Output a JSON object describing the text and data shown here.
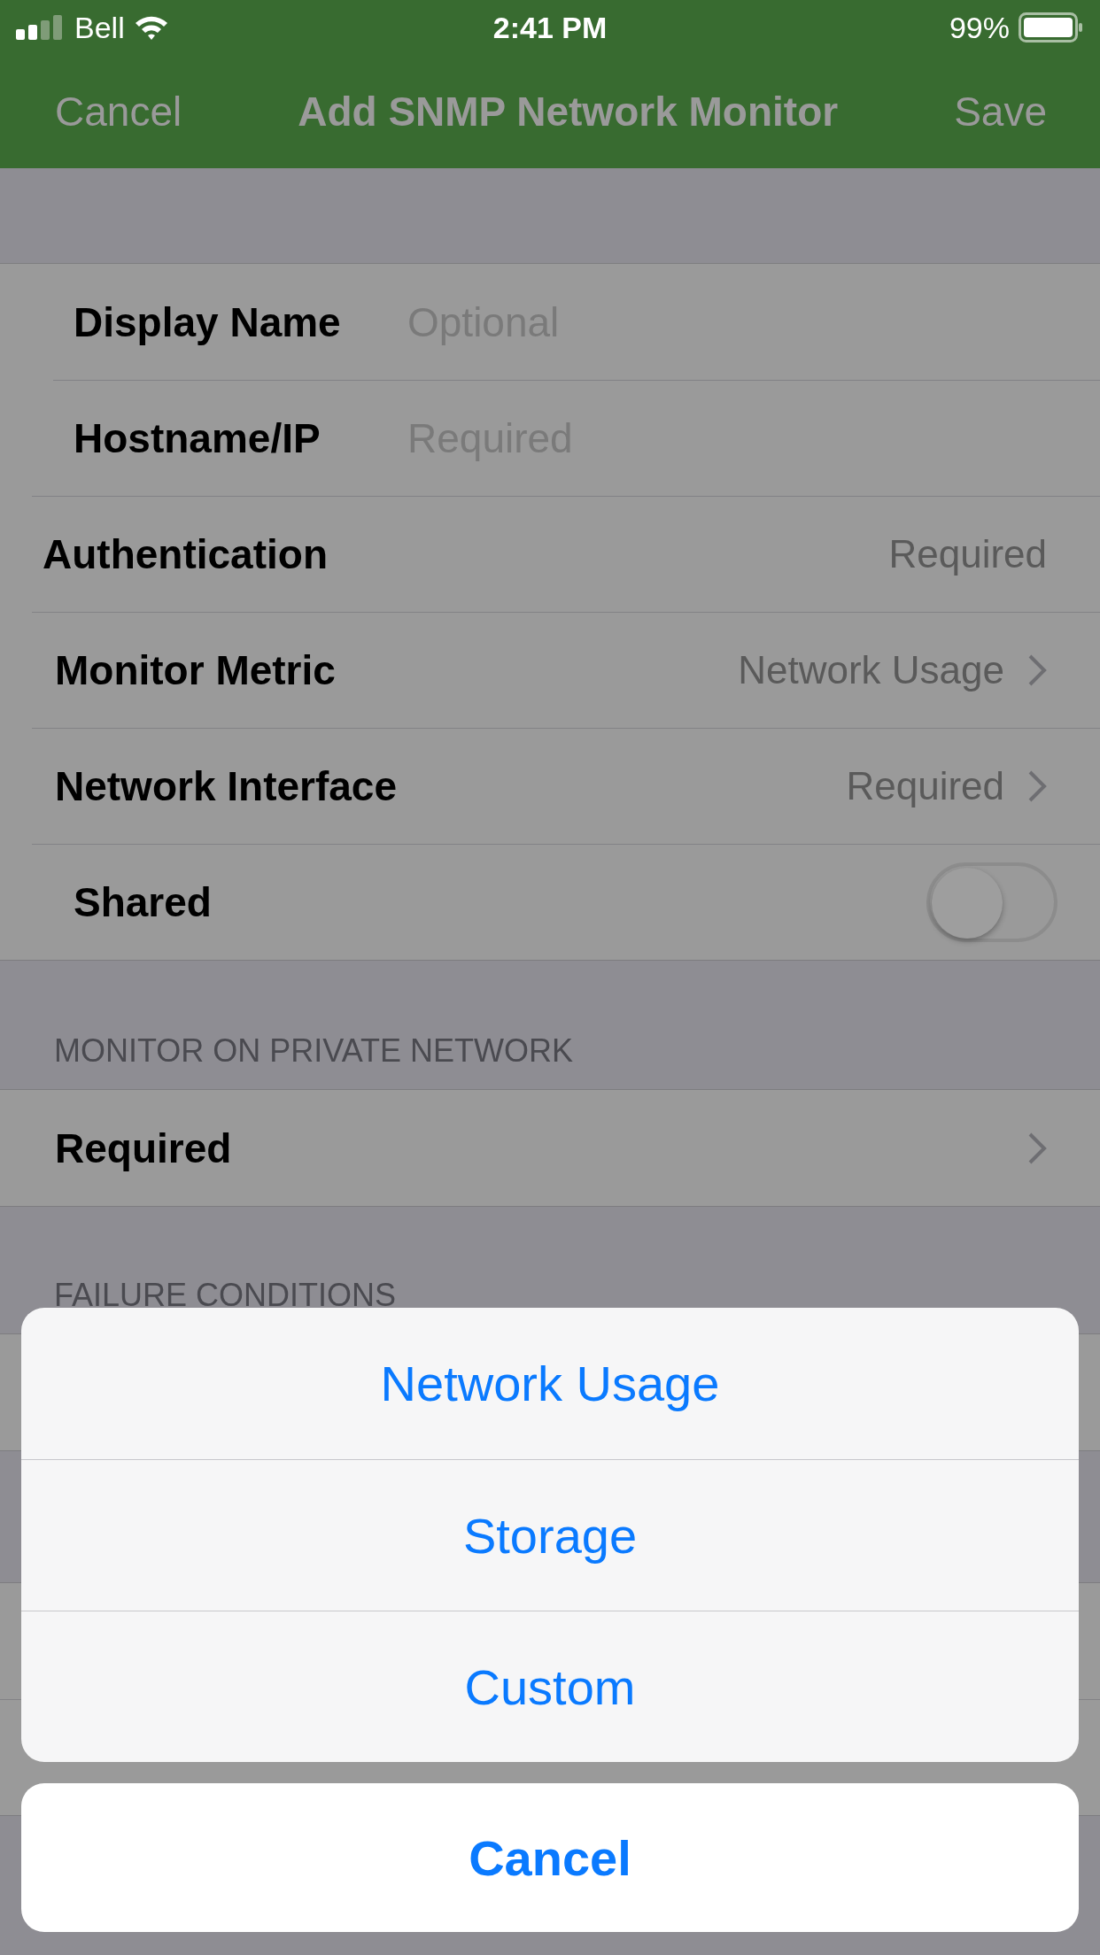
{
  "status_bar": {
    "carrier": "Bell",
    "time": "2:41 PM",
    "battery": "99%"
  },
  "nav": {
    "left": "Cancel",
    "title": "Add SNMP Network Monitor",
    "right": "Save"
  },
  "form": [
    {
      "kind": "field",
      "label": "Display Name",
      "placeholder": "Optional"
    },
    {
      "kind": "field",
      "label": "Hostname/IP",
      "placeholder": "Required"
    },
    {
      "kind": "value",
      "label": "Authentication",
      "value": "Required"
    },
    {
      "kind": "disclosure",
      "label": "Monitor Metric",
      "value": "Network Usage"
    },
    {
      "kind": "disclosure",
      "label": "Network Interface",
      "value": "Required"
    },
    {
      "kind": "toggle",
      "label": "Shared",
      "on": false
    }
  ],
  "private_network": {
    "header": "MONITOR ON PRIVATE NETWORK",
    "row": "Required"
  },
  "failure_conditions": {
    "header": "FAILURE CONDITIONS"
  },
  "action_sheet": {
    "options": [
      "Network Usage",
      "Storage",
      "Custom"
    ],
    "cancel": "Cancel"
  }
}
